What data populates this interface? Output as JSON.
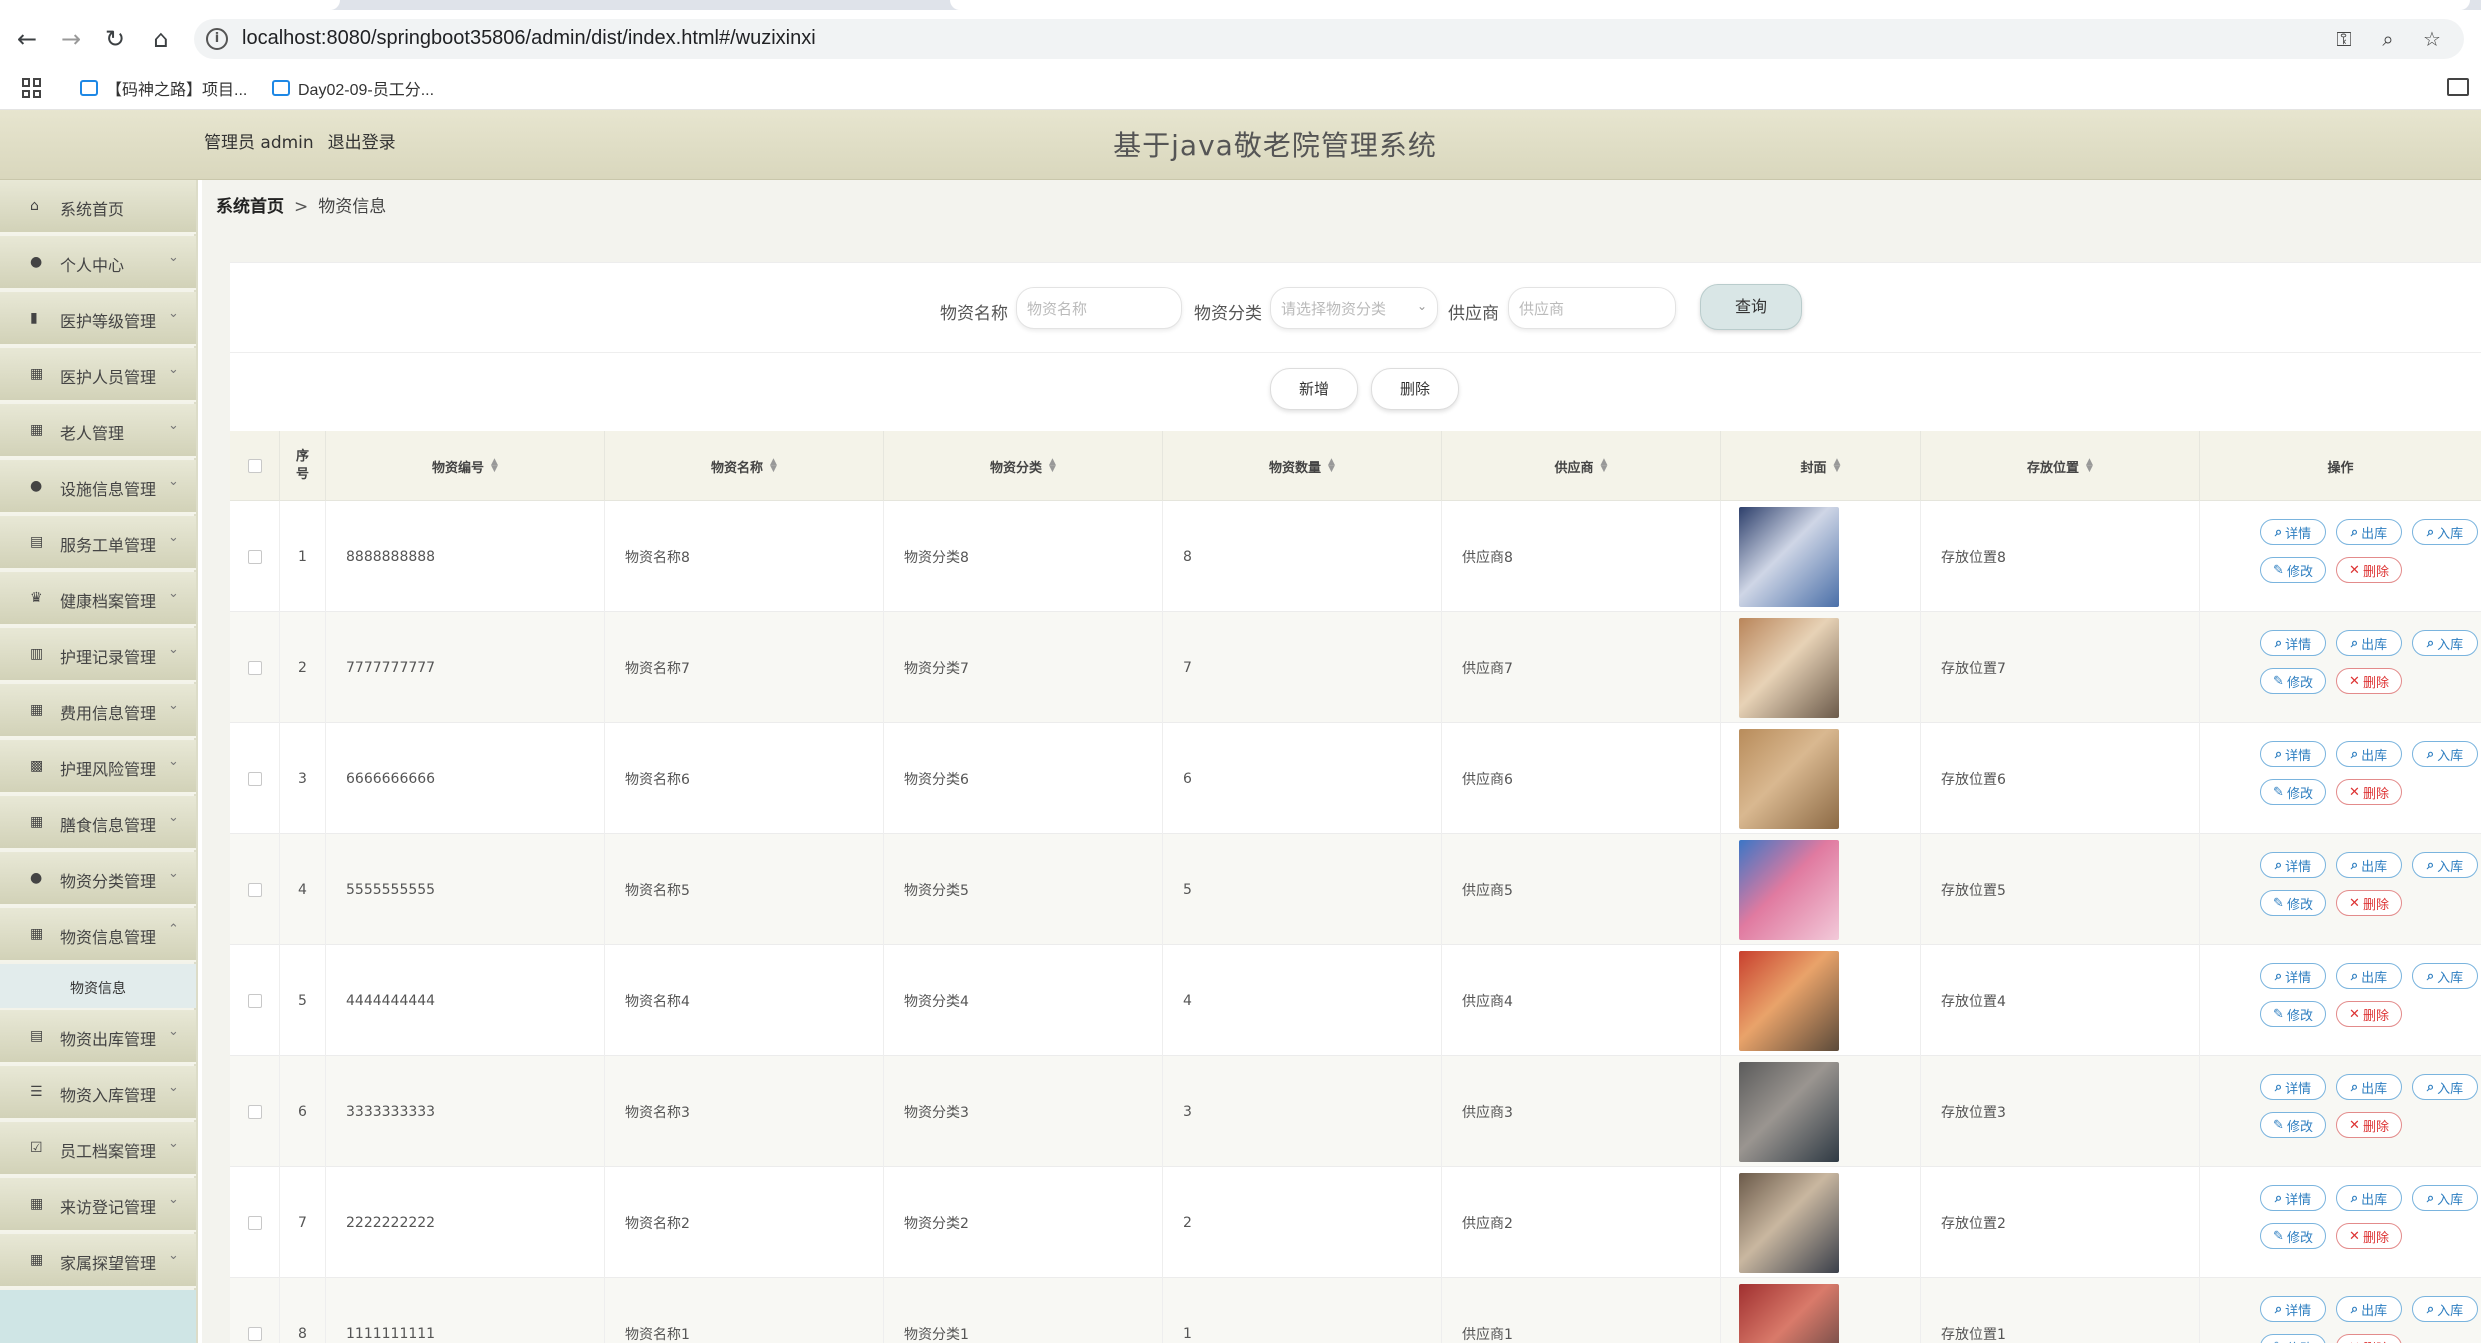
{
  "browser": {
    "url": "localhost:8080/springboot35806/admin/dist/index.html#/wuzixinxi",
    "bookmarks": [
      "【码神之路】项目...",
      "Day02-09-员工分..."
    ]
  },
  "header": {
    "role": "管理员 admin",
    "logout": "退出登录",
    "title": "基于java敬老院管理系统"
  },
  "sidebar": {
    "items": [
      {
        "label": "系统首页",
        "icon": "home-icon"
      },
      {
        "label": "个人中心",
        "icon": "user-icon"
      },
      {
        "label": "医护等级管理",
        "icon": "bars-icon"
      },
      {
        "label": "医护人员管理",
        "icon": "grid-icon"
      },
      {
        "label": "老人管理",
        "icon": "grid-icon"
      },
      {
        "label": "设施信息管理",
        "icon": "user-icon"
      },
      {
        "label": "服务工单管理",
        "icon": "clipboard-icon"
      },
      {
        "label": "健康档案管理",
        "icon": "trophy-icon"
      },
      {
        "label": "护理记录管理",
        "icon": "bar-chart-icon"
      },
      {
        "label": "费用信息管理",
        "icon": "grid-icon"
      },
      {
        "label": "护理风险管理",
        "icon": "grid-dense-icon"
      },
      {
        "label": "膳食信息管理",
        "icon": "grid-icon"
      },
      {
        "label": "物资分类管理",
        "icon": "user-icon"
      },
      {
        "label": "物资信息管理",
        "icon": "grid-icon"
      },
      {
        "label": "物资出库管理",
        "icon": "clipboard-icon"
      },
      {
        "label": "物资入库管理",
        "icon": "list-icon"
      },
      {
        "label": "员工档案管理",
        "icon": "checkbox-icon"
      },
      {
        "label": "来访登记管理",
        "icon": "grid-icon"
      },
      {
        "label": "家属探望管理",
        "icon": "grid-icon"
      }
    ],
    "active_sub": "物资信息"
  },
  "breadcrumb": {
    "home": "系统首页",
    "sep": ">",
    "current": "物资信息"
  },
  "search": {
    "name_label": "物资名称",
    "name_placeholder": "物资名称",
    "category_label": "物资分类",
    "category_placeholder": "请选择物资分类",
    "supplier_label": "供应商",
    "supplier_placeholder": "供应商",
    "query_button": "查询"
  },
  "actions": {
    "add": "新增",
    "delete": "删除"
  },
  "table": {
    "headers": [
      "序号",
      "物资编号",
      "物资名称",
      "物资分类",
      "物资数量",
      "供应商",
      "封面",
      "存放位置",
      "操作"
    ],
    "rows": [
      {
        "index": "1",
        "code": "8888888888",
        "name": "物资名称8",
        "category": "物资分类8",
        "qty": "8",
        "supplier": "供应商8",
        "location": "存放位置8"
      },
      {
        "index": "2",
        "code": "7777777777",
        "name": "物资名称7",
        "category": "物资分类7",
        "qty": "7",
        "supplier": "供应商7",
        "location": "存放位置7"
      },
      {
        "index": "3",
        "code": "6666666666",
        "name": "物资名称6",
        "category": "物资分类6",
        "qty": "6",
        "supplier": "供应商6",
        "location": "存放位置6"
      },
      {
        "index": "4",
        "code": "5555555555",
        "name": "物资名称5",
        "category": "物资分类5",
        "qty": "5",
        "supplier": "供应商5",
        "location": "存放位置5"
      },
      {
        "index": "5",
        "code": "4444444444",
        "name": "物资名称4",
        "category": "物资分类4",
        "qty": "4",
        "supplier": "供应商4",
        "location": "存放位置4"
      },
      {
        "index": "6",
        "code": "3333333333",
        "name": "物资名称3",
        "category": "物资分类3",
        "qty": "3",
        "supplier": "供应商3",
        "location": "存放位置3"
      },
      {
        "index": "7",
        "code": "2222222222",
        "name": "物资名称2",
        "category": "物资分类2",
        "qty": "2",
        "supplier": "供应商2",
        "location": "存放位置2"
      },
      {
        "index": "8",
        "code": "1111111111",
        "name": "物资名称1",
        "category": "物资分类1",
        "qty": "1",
        "supplier": "供应商1",
        "location": "存放位置1"
      }
    ],
    "ops": {
      "detail": "详情",
      "out": "出库",
      "in": "入库",
      "edit": "修改",
      "del": "删除"
    }
  },
  "colors": {
    "header_bg": "#dedcc4",
    "accent_blue": "#2f7fc1",
    "danger": "#d33333"
  }
}
